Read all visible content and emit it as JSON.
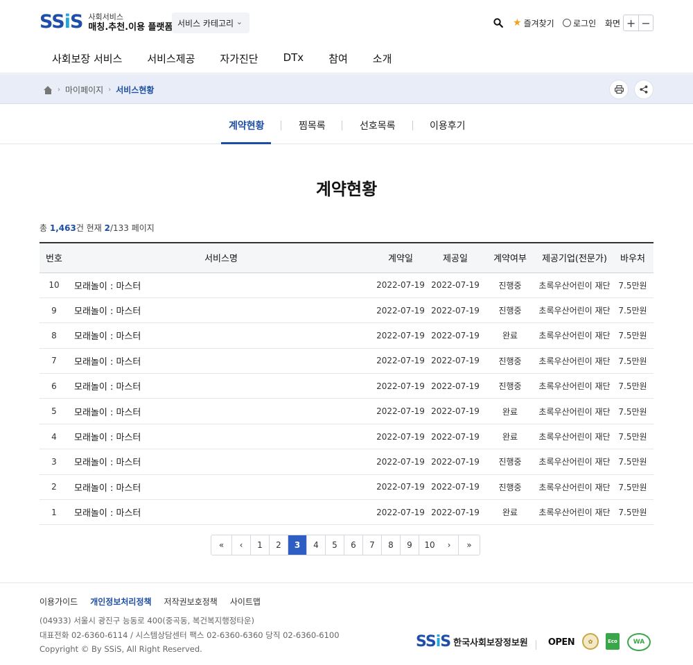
{
  "header": {
    "logo_mark_a": "SS",
    "logo_mark_i": "i",
    "logo_mark_b": "S",
    "logo_line1": "사회서비스",
    "logo_line2": "매칭.추천.이용 플랫폼",
    "category_label": "서비스 카테고리",
    "favorites_label": "즐겨찾기",
    "login_label": "로그인",
    "zoom_label": "화면",
    "zoom_in": "+",
    "zoom_out": "−"
  },
  "gnb": [
    "사회보장 서비스",
    "서비스제공",
    "자가진단",
    "DTx",
    "참여",
    "소개"
  ],
  "breadcrumb": {
    "level1": "마이페이지",
    "current": "서비스현황"
  },
  "tabs": [
    "계약현황",
    "찜목록",
    "선호목록",
    "이용후기"
  ],
  "page_title": "계약현황",
  "count": {
    "prefix": "총 ",
    "total": "1,463",
    "mid": "건 현재 ",
    "page": "2",
    "suffix": "/133 페이지"
  },
  "table": {
    "headers": [
      "번호",
      "서비스명",
      "계약일",
      "제공일",
      "계약여부",
      "제공기업(전문가)",
      "바우처"
    ],
    "rows": [
      {
        "no": "10",
        "name": "모래놀이 : 마스터",
        "contract": "2022-07-19",
        "provide": "2022-07-19",
        "status": "진행중",
        "company": "초록우산어린이 재단",
        "voucher": "7.5만원"
      },
      {
        "no": "9",
        "name": "모래놀이 : 마스터",
        "contract": "2022-07-19",
        "provide": "2022-07-19",
        "status": "진행중",
        "company": "초록우산어린이 재단",
        "voucher": "7.5만원"
      },
      {
        "no": "8",
        "name": "모래놀이 : 마스터",
        "contract": "2022-07-19",
        "provide": "2022-07-19",
        "status": "완료",
        "company": "초록우산어린이 재단",
        "voucher": "7.5만원"
      },
      {
        "no": "7",
        "name": "모래놀이 : 마스터",
        "contract": "2022-07-19",
        "provide": "2022-07-19",
        "status": "진행중",
        "company": "초록우산어린이 재단",
        "voucher": "7.5만원"
      },
      {
        "no": "6",
        "name": "모래놀이 : 마스터",
        "contract": "2022-07-19",
        "provide": "2022-07-19",
        "status": "진행중",
        "company": "초록우산어린이 재단",
        "voucher": "7.5만원"
      },
      {
        "no": "5",
        "name": "모래놀이 : 마스터",
        "contract": "2022-07-19",
        "provide": "2022-07-19",
        "status": "완료",
        "company": "초록우산어린이 재단",
        "voucher": "7.5만원"
      },
      {
        "no": "4",
        "name": "모래놀이 : 마스터",
        "contract": "2022-07-19",
        "provide": "2022-07-19",
        "status": "완료",
        "company": "초록우산어린이 재단",
        "voucher": "7.5만원"
      },
      {
        "no": "3",
        "name": "모래놀이 : 마스터",
        "contract": "2022-07-19",
        "provide": "2022-07-19",
        "status": "진행중",
        "company": "초록우산어린이 재단",
        "voucher": "7.5만원"
      },
      {
        "no": "2",
        "name": "모래놀이 : 마스터",
        "contract": "2022-07-19",
        "provide": "2022-07-19",
        "status": "진행중",
        "company": "초록우산어린이 재단",
        "voucher": "7.5만원"
      },
      {
        "no": "1",
        "name": "모래놀이 : 마스터",
        "contract": "2022-07-19",
        "provide": "2022-07-19",
        "status": "완료",
        "company": "초록우산어린이 재단",
        "voucher": "7.5만원"
      }
    ]
  },
  "status_colors": {
    "진행중": "#2a5db8",
    "완료": "#e55454"
  },
  "pagination": {
    "first": "«",
    "prev": "‹",
    "pages": [
      "1",
      "2",
      "3",
      "4",
      "5",
      "6",
      "7",
      "8",
      "9",
      "10"
    ],
    "active": "3",
    "next": "›",
    "last": "»"
  },
  "footer": {
    "links": [
      "이용가이드",
      "개인정보처리정책",
      "저작권보호정책",
      "사이트맵"
    ],
    "address": "(04933) 서울시 광진구 능동로 400(중곡동, 복건복지행정타운)",
    "phones": "대표전화 02-6360-6114 / 시스템상담센터   팩스 02-6360-6360   당직 02-6360-6100",
    "copyright": "Copyright © By SSiS, All Right Reserved.",
    "org_name": "한국사회보장정보원",
    "badge_open": "OPEN",
    "badge_eco": "Eco",
    "badge_wa": "WA"
  },
  "icons": {
    "search": "search-icon",
    "star": "star-icon",
    "user": "user-icon",
    "home": "home-icon",
    "print": "print-icon",
    "share": "share-icon",
    "chevron": "chevron-down-icon"
  }
}
